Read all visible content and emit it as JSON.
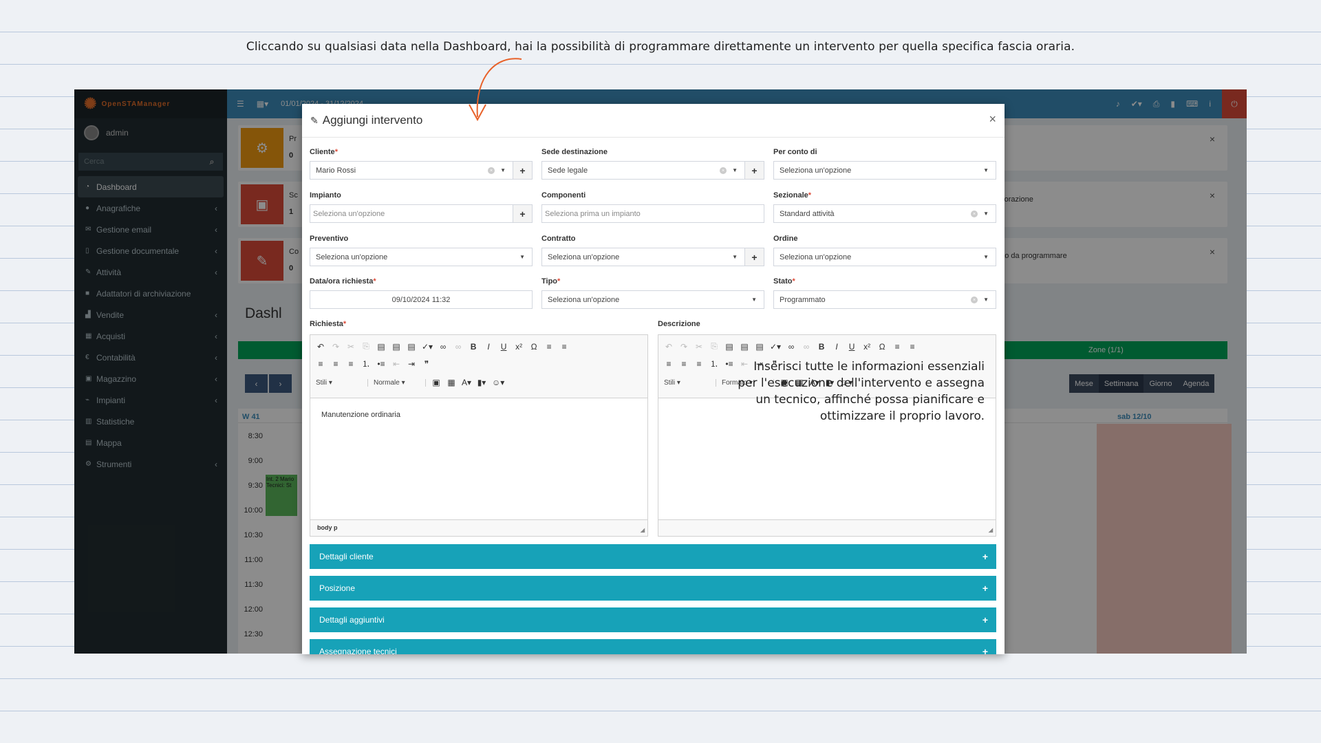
{
  "caption": "Cliccando su qualsiasi data nella Dashboard, hai la possibilità di programmare direttamente un intervento per quella specifica fascia oraria.",
  "app": {
    "logo": "OpenSTAManager",
    "user": "admin",
    "search_placeholder": "Cerca",
    "date_range": "01/01/2024 - 31/12/2024",
    "menu": [
      "Dashboard",
      "Anagrafiche",
      "Gestione email",
      "Gestione documentale",
      "Attività",
      "Adattatori di archiviazione",
      "Vendite",
      "Acquisti",
      "Contabilità",
      "Magazzino",
      "Impianti",
      "Statistiche",
      "Mappa",
      "Strumenti"
    ],
    "infobox": [
      {
        "label": "Pr",
        "count": "0"
      },
      {
        "label": "Sc",
        "count": "1",
        "right": "avorazione"
      },
      {
        "label": "Co",
        "count": "0",
        "right": "tato da programmare"
      }
    ],
    "dashboard_title": "Dashl",
    "zone": "Zone (1/1)",
    "views": [
      "Mese",
      "Settimana",
      "Giorno",
      "Agenda"
    ],
    "week": "W 41",
    "saturday": "sab 12/10",
    "times": [
      "8:30",
      "9:00",
      "9:30",
      "10:00",
      "10:30",
      "11:00",
      "11:30",
      "12:00",
      "12:30"
    ],
    "event": {
      "line1": "Int. 2 Mario",
      "line2": "Tecnici: St"
    }
  },
  "modal": {
    "title": "Aggiungi intervento",
    "close": "×",
    "fields": {
      "cliente": {
        "label": "Cliente",
        "value": "Mario Rossi"
      },
      "sede": {
        "label": "Sede destinazione",
        "value": "Sede legale"
      },
      "conto": {
        "label": "Per conto di",
        "value": "Seleziona un'opzione"
      },
      "impianto": {
        "label": "Impianto",
        "value": "Seleziona un'opzione"
      },
      "componenti": {
        "label": "Componenti",
        "value": "Seleziona prima un impianto"
      },
      "sezionale": {
        "label": "Sezionale",
        "value": "Standard attività"
      },
      "preventivo": {
        "label": "Preventivo",
        "value": "Seleziona un'opzione"
      },
      "contratto": {
        "label": "Contratto",
        "value": "Seleziona un'opzione"
      },
      "ordine": {
        "label": "Ordine",
        "value": "Seleziona un'opzione"
      },
      "data": {
        "label": "Data/ora richiesta",
        "value": "09/10/2024 11:32"
      },
      "tipo": {
        "label": "Tipo",
        "value": "Seleziona un'opzione"
      },
      "stato": {
        "label": "Stato",
        "value": "Programmato"
      }
    },
    "richiesta": {
      "label": "Richiesta",
      "body": "Manutenzione ordinaria",
      "styles": "Stili",
      "format": "Normale",
      "footer_tags": "body  p"
    },
    "descrizione": {
      "label": "Descrizione",
      "styles": "Stili",
      "format": "Formato"
    },
    "note": "Inserisci tutte le informazioni essenziali per l'esecuzione dell'intervento e assegna un tecnico, affinché possa pianificare e ottimizzare il proprio lavoro.",
    "accordions": [
      "Dettagli cliente",
      "Posizione",
      "Dettagli aggiuntivi",
      "Assegnazione tecnici"
    ]
  },
  "colors": {
    "accent": "#3c8dbc",
    "accordion": "#17a2b8",
    "required": "#dd4b39",
    "annotation_arrow": "#e8622a"
  }
}
